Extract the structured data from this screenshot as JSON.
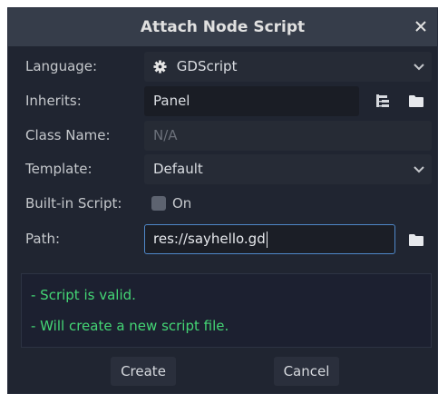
{
  "dialog": {
    "title": "Attach Node Script",
    "close_icon": "close-icon"
  },
  "form": {
    "language": {
      "label": "Language:",
      "value": "GDScript",
      "icon": "gear-icon"
    },
    "inherits": {
      "label": "Inherits:",
      "value": "Panel"
    },
    "class_name": {
      "label": "Class Name:",
      "placeholder": "N/A"
    },
    "template": {
      "label": "Template:",
      "value": "Default"
    },
    "builtin": {
      "label": "Built-in Script:",
      "checkbox_label": "On",
      "checked": false
    },
    "path": {
      "label": "Path:",
      "value": "res://sayhello.gd"
    }
  },
  "status": {
    "lines": [
      "- Script is valid.",
      "- Will create a new script file."
    ],
    "color": "#44d675"
  },
  "buttons": {
    "create": "Create",
    "cancel": "Cancel"
  },
  "colors": {
    "background": "#202531",
    "titlebar": "#363d4a",
    "accent": "#4f88c9"
  }
}
